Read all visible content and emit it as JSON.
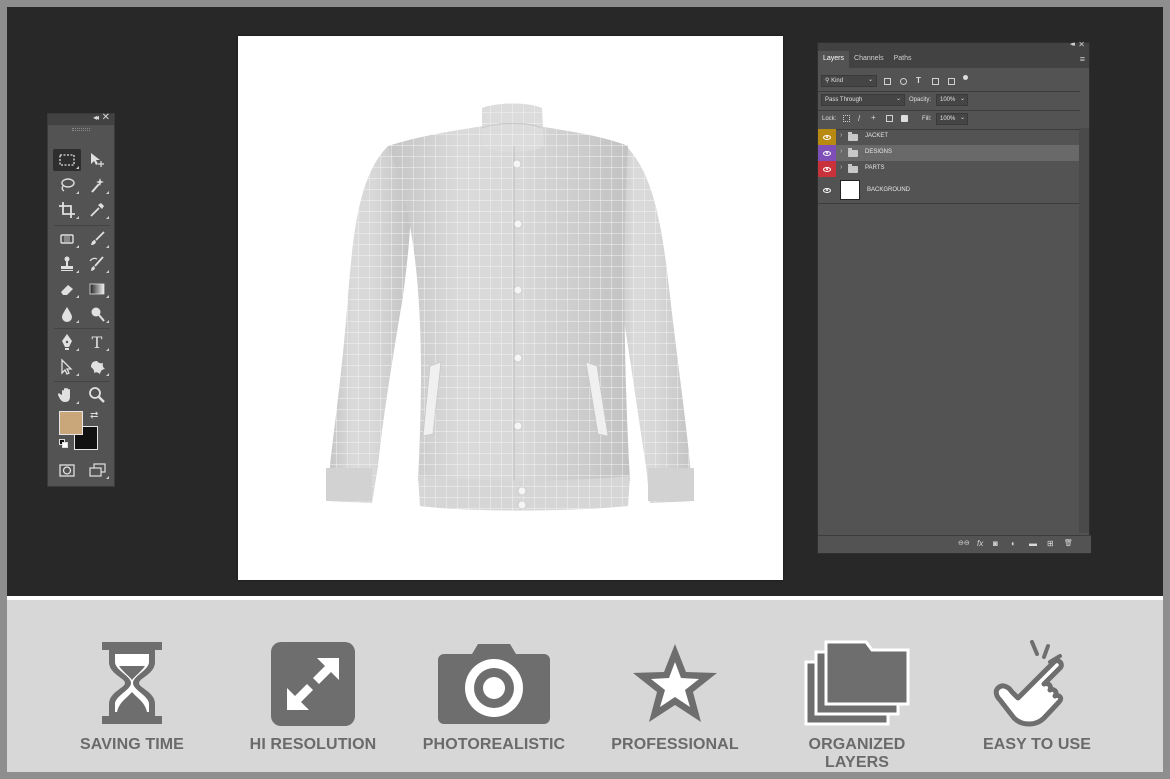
{
  "toolbox": {
    "collapse_glyph": "◂◂",
    "close_glyph": "✕",
    "tools": [
      {
        "name": "marquee",
        "icon": "rect-marquee-icon"
      },
      {
        "name": "move",
        "icon": "move-icon"
      },
      {
        "name": "lasso",
        "icon": "lasso-icon"
      },
      {
        "name": "magic-wand",
        "icon": "magic-wand-icon"
      },
      {
        "name": "crop",
        "icon": "crop-icon"
      },
      {
        "name": "eyedropper",
        "icon": "eyedropper-icon"
      },
      {
        "name": "healing",
        "icon": "healing-brush-icon"
      },
      {
        "name": "brush",
        "icon": "brush-icon"
      },
      {
        "name": "stamp",
        "icon": "clone-stamp-icon"
      },
      {
        "name": "history-brush",
        "icon": "history-brush-icon"
      },
      {
        "name": "eraser",
        "icon": "eraser-icon"
      },
      {
        "name": "gradient",
        "icon": "gradient-icon"
      },
      {
        "name": "blur",
        "icon": "blur-icon"
      },
      {
        "name": "dodge",
        "icon": "dodge-icon"
      },
      {
        "name": "pen",
        "icon": "pen-icon"
      },
      {
        "name": "type",
        "icon": "type-icon"
      },
      {
        "name": "path-select",
        "icon": "path-selection-icon"
      },
      {
        "name": "shape",
        "icon": "custom-shape-icon"
      },
      {
        "name": "hand",
        "icon": "hand-icon"
      },
      {
        "name": "zoom",
        "icon": "zoom-icon"
      },
      {
        "name": "quick-mask",
        "icon": "quick-mask-icon"
      },
      {
        "name": "screen-mode",
        "icon": "screen-mode-icon"
      }
    ],
    "type_glyph": "T",
    "swap_glyph": "⇄",
    "foreground_color": "#c9a77a",
    "background_color": "#111111"
  },
  "layers_panel": {
    "collapse_glyph": "◂◂",
    "close_glyph": "✕",
    "menu_glyph": "≡",
    "tabs": [
      "Layers",
      "Channels",
      "Paths"
    ],
    "active_tab": "Layers",
    "filter_label": "Kind",
    "search_glyph": "⚲",
    "dropdown_glyph": "⌄",
    "blend_mode": "Pass Through",
    "opacity_label": "Opacity:",
    "opacity_value": "100%",
    "lock_label": "Lock:",
    "fill_label": "Fill:",
    "fill_value": "100%",
    "expand_glyph": "›",
    "layers": [
      {
        "name": "JACKET",
        "type": "group",
        "color": "#b88a12",
        "selected": false
      },
      {
        "name": "DESIGNS",
        "type": "group",
        "color": "#7e4fb6",
        "selected": true
      },
      {
        "name": "PARTS",
        "type": "group",
        "color": "#c9323b",
        "selected": false
      },
      {
        "name": "BACKGROUND",
        "type": "layer",
        "color": null,
        "selected": false
      }
    ],
    "footer_icons": [
      "link-icon",
      "fx-icon",
      "mask-icon",
      "adjustment-icon",
      "group-icon",
      "new-layer-icon",
      "trash-icon"
    ],
    "footer_glyphs": {
      "link": "⊖⊖",
      "fx": "fx",
      "mask": "◙",
      "adjustment": "◐",
      "group": "▬",
      "new_layer": "⊞",
      "trash": "🗑"
    }
  },
  "features": [
    {
      "label": "SAVING TIME",
      "icon": "hourglass-icon"
    },
    {
      "label": "HI RESOLUTION",
      "icon": "expand-arrows-icon"
    },
    {
      "label": "PHOTOREALISTIC",
      "icon": "camera-icon"
    },
    {
      "label": "PROFESSIONAL",
      "icon": "star-icon"
    },
    {
      "label": "ORGANIZED LAYERS",
      "icon": "stacked-folders-icon"
    },
    {
      "label": "EASY TO USE",
      "icon": "tap-hand-icon"
    }
  ],
  "colors": {
    "workspace": "#282828",
    "panel": "#535353",
    "feature_icon": "#6e6e6e",
    "feature_bg": "#d7d7d7"
  }
}
